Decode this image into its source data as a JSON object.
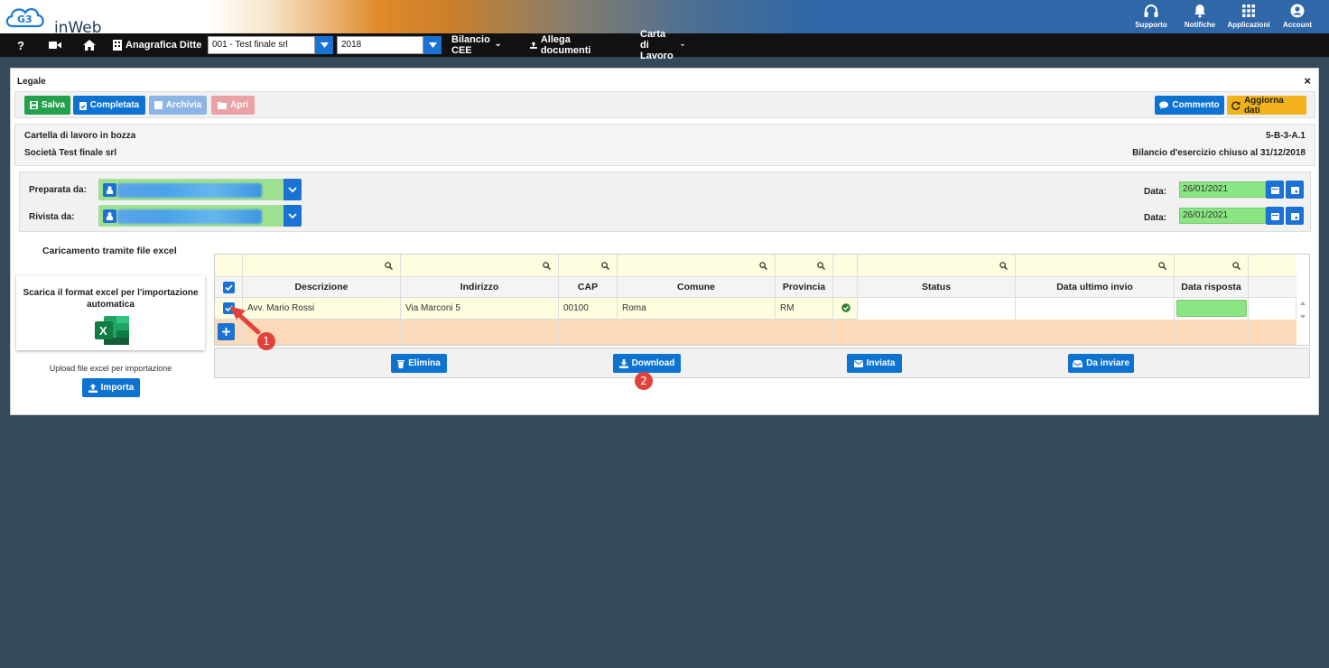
{
  "app": {
    "logo_text": "inWeb"
  },
  "top_icons": [
    {
      "label": "Supporto",
      "icon": "headset-icon"
    },
    {
      "label": "Notifiche",
      "icon": "bell-icon"
    },
    {
      "label": "Applicazioni",
      "icon": "grid-icon"
    },
    {
      "label": "Account",
      "icon": "account-icon"
    }
  ],
  "nav": {
    "help": "?",
    "anagrafica_label": "Anagrafica Ditte",
    "company_value": "001 - Test finale srl",
    "year_value": "2018",
    "bilancio_label": "Bilancio CEE",
    "allega_label": "Allega documenti",
    "carta_label": "Carta di Lavoro"
  },
  "panel": {
    "title": "Legale",
    "close": "×"
  },
  "toolbar": {
    "salva": "Salva",
    "completata": "Completata",
    "archivia": "Archivia",
    "apri": "Apri",
    "commento": "Commento",
    "aggiorna": "Aggiorna dati"
  },
  "info": {
    "status": "Cartella di lavoro in bozza",
    "company": "Società Test finale srl",
    "code": "5-B-3-A.1",
    "bilancio": "Bilancio d'esercizio chiuso al 31/12/2018"
  },
  "assign": {
    "preparata_label": "Preparata da:",
    "rivista_label": "Rivista da:",
    "data_label": "Data:",
    "preparata_date": "26/01/2021",
    "rivista_date": "26/01/2021"
  },
  "excel": {
    "title": "Caricamento tramite file excel",
    "card_text": "Scarica il format excel per l'importazione automatica",
    "upload_text": "Upload file excel per importazione",
    "importa": "Importa"
  },
  "grid": {
    "columns": [
      "Descrizione",
      "Indirizzo",
      "CAP",
      "Comune",
      "Provincia",
      "",
      "Status",
      "Data ultimo invio",
      "Data risposta"
    ],
    "rows": [
      {
        "descrizione": "Avv. Mario Rossi",
        "indirizzo": "Via Marconi 5",
        "cap": "00100",
        "comune": "Roma",
        "provincia": "RM",
        "status": "",
        "data_ultimo_invio": "",
        "data_risposta": ""
      }
    ]
  },
  "actions": {
    "elimina": "Elimina",
    "download": "Download",
    "inviata": "Inviata",
    "da_inviare": "Da inviare"
  },
  "annotations": {
    "badge1": "1",
    "badge2": "2"
  },
  "colors": {
    "primary": "#0d72d0",
    "success": "#22a04b",
    "warning": "#f2b21b",
    "filled_field": "#8ae682",
    "annotation": "#e0433a"
  }
}
